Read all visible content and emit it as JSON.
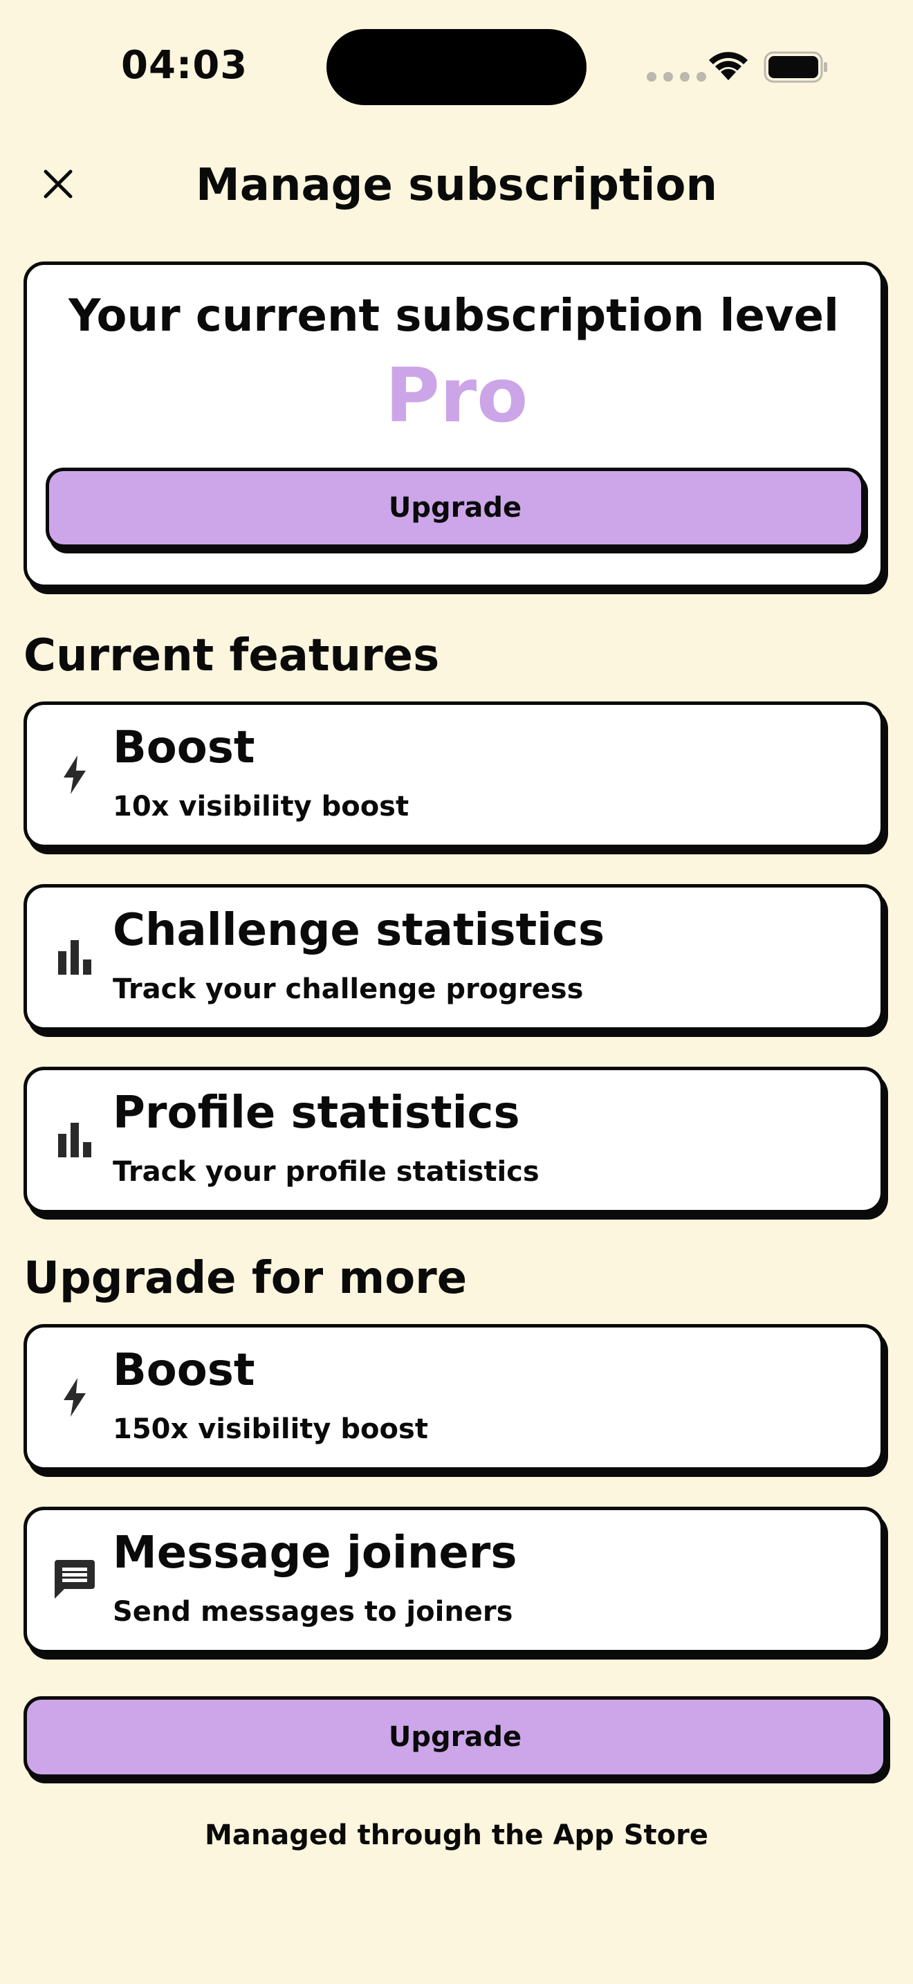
{
  "status_bar": {
    "time": "04:03"
  },
  "header": {
    "title": "Manage subscription",
    "close_icon": "close-icon"
  },
  "subscription": {
    "heading": "Your current subscription level",
    "level": "Pro",
    "upgrade_label": "Upgrade"
  },
  "current_features": {
    "title": "Current features",
    "items": [
      {
        "icon": "lightning-icon",
        "title": "Boost",
        "description": "10x visibility boost"
      },
      {
        "icon": "bar-chart-icon",
        "title": "Challenge statistics",
        "description": "Track your challenge progress"
      },
      {
        "icon": "bar-chart-icon",
        "title": "Profile statistics",
        "description": "Track your profile statistics"
      }
    ]
  },
  "upgrade_features": {
    "title": "Upgrade for more",
    "items": [
      {
        "icon": "lightning-icon",
        "title": "Boost",
        "description": "150x visibility boost"
      },
      {
        "icon": "message-icon",
        "title": "Message joiners",
        "description": "Send messages to joiners"
      }
    ]
  },
  "bottom": {
    "upgrade_label": "Upgrade",
    "footer_note": "Managed through the App Store"
  },
  "colors": {
    "background": "#fdf6de",
    "accent_purple": "#cca6e9",
    "level_purple": "#cba5e8",
    "card": "#ffffff",
    "ink": "#0a0a0a"
  }
}
